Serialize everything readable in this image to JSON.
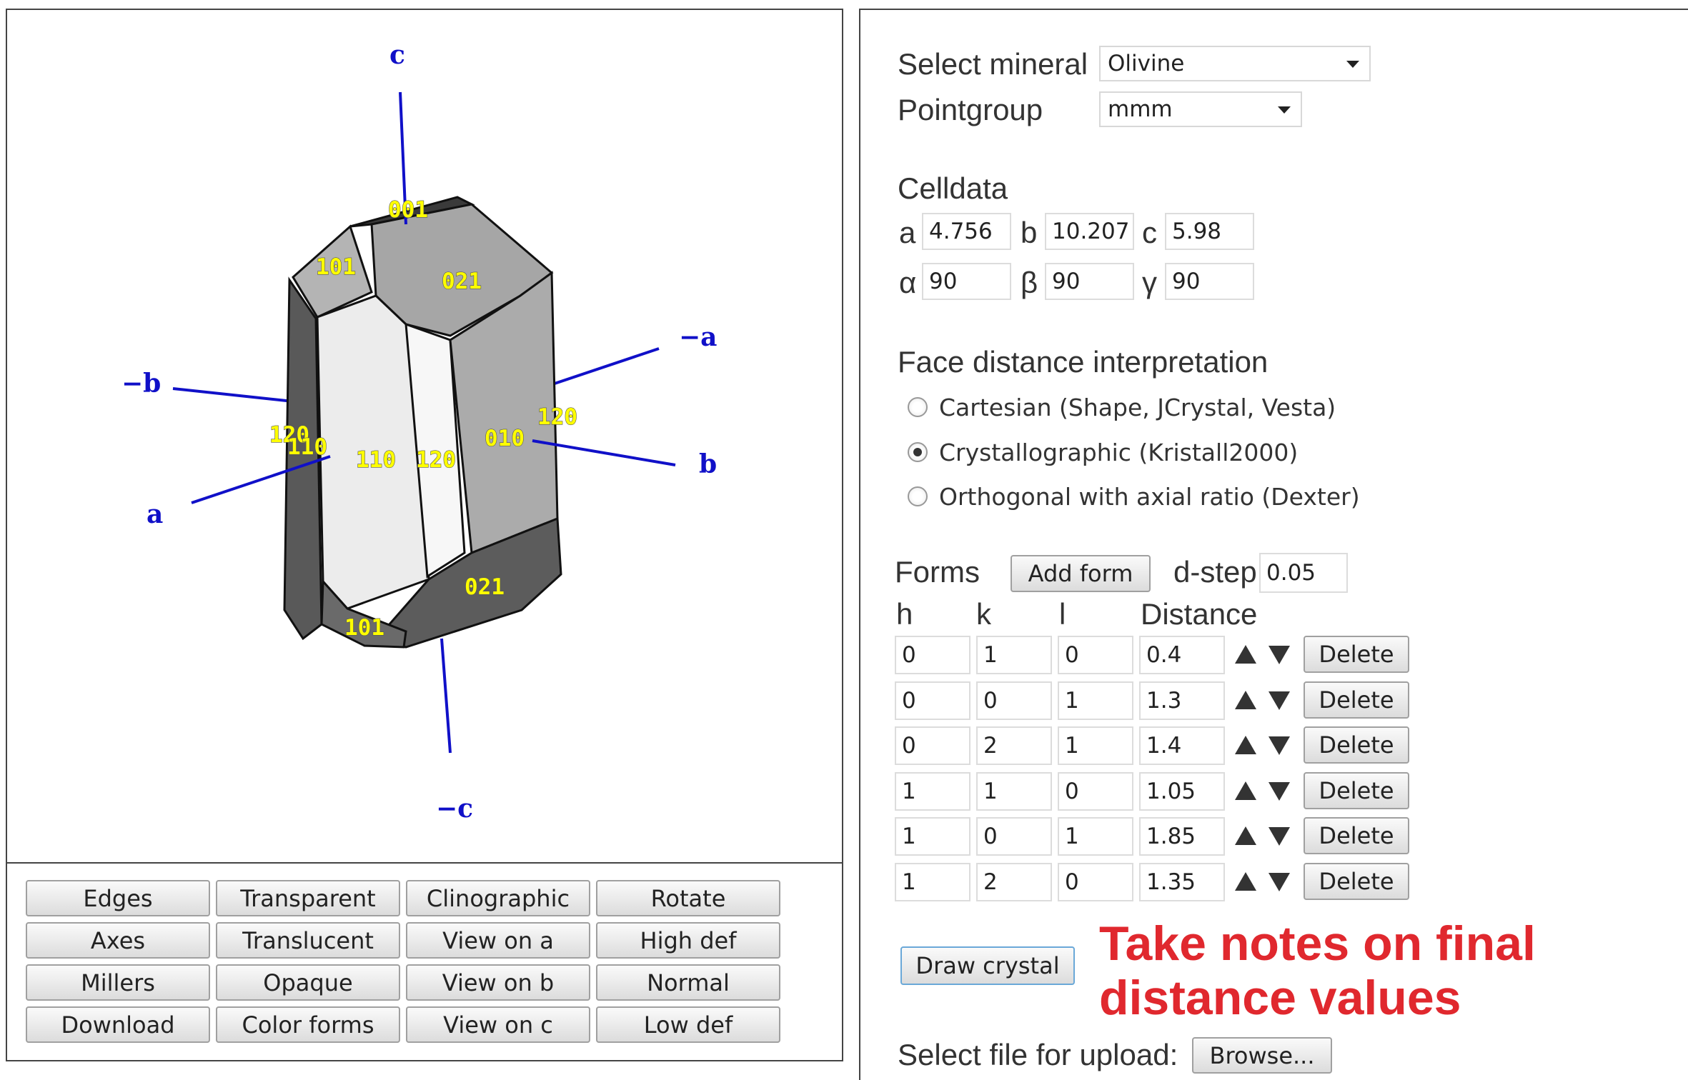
{
  "viewer": {
    "axes": {
      "c": "c",
      "neg_c": "−c",
      "a": "a",
      "neg_a": "−a",
      "b": "b",
      "neg_b": "−b"
    },
    "miller_labels": [
      "001",
      "101",
      "021",
      "120",
      "110",
      "110",
      "120",
      "010",
      "120",
      "021",
      "101"
    ],
    "colors": {
      "axis": "#1010c8",
      "miller": "#ffff00"
    }
  },
  "view_buttons": [
    "Edges",
    "Transparent",
    "Clinographic",
    "Rotate",
    "Axes",
    "Translucent",
    "View on a",
    "High def",
    "Millers",
    "Opaque",
    "View on b",
    "Normal",
    "Download",
    "Color forms",
    "View on c",
    "Low def"
  ],
  "mineral": {
    "label": "Select mineral",
    "value": "Olivine"
  },
  "pointgroup": {
    "label": "Pointgroup",
    "value": "mmm"
  },
  "celldata": {
    "title": "Celldata",
    "a_label": "a",
    "a": "4.756",
    "b_label": "b",
    "b": "10.207",
    "c_label": "c",
    "c": "5.98",
    "alpha_label": "α",
    "alpha": "90",
    "beta_label": "β",
    "beta": "90",
    "gamma_label": "γ",
    "gamma": "90"
  },
  "face_distance": {
    "title": "Face distance interpretation",
    "options": [
      "Cartesian (Shape, JCrystal, Vesta)",
      "Crystallographic (Kristall2000)",
      "Orthogonal with axial ratio (Dexter)"
    ],
    "selected_index": 1
  },
  "forms": {
    "title": "Forms",
    "add_button": "Add form",
    "dstep_label": "d-step",
    "dstep": "0.05",
    "headers": {
      "h": "h",
      "k": "k",
      "l": "l",
      "distance": "Distance"
    },
    "delete_label": "Delete",
    "rows": [
      {
        "h": "0",
        "k": "1",
        "l": "0",
        "d": "0.4"
      },
      {
        "h": "0",
        "k": "0",
        "l": "1",
        "d": "1.3"
      },
      {
        "h": "0",
        "k": "2",
        "l": "1",
        "d": "1.4"
      },
      {
        "h": "1",
        "k": "1",
        "l": "0",
        "d": "1.05"
      },
      {
        "h": "1",
        "k": "0",
        "l": "1",
        "d": "1.85"
      },
      {
        "h": "1",
        "k": "2",
        "l": "0",
        "d": "1.35"
      }
    ]
  },
  "draw_button": "Draw crystal",
  "note": {
    "line1": "Take notes on final",
    "line2": "distance values",
    "color": "#e0282e"
  },
  "upload": {
    "label": "Select file for upload:",
    "button": "Browse..."
  }
}
